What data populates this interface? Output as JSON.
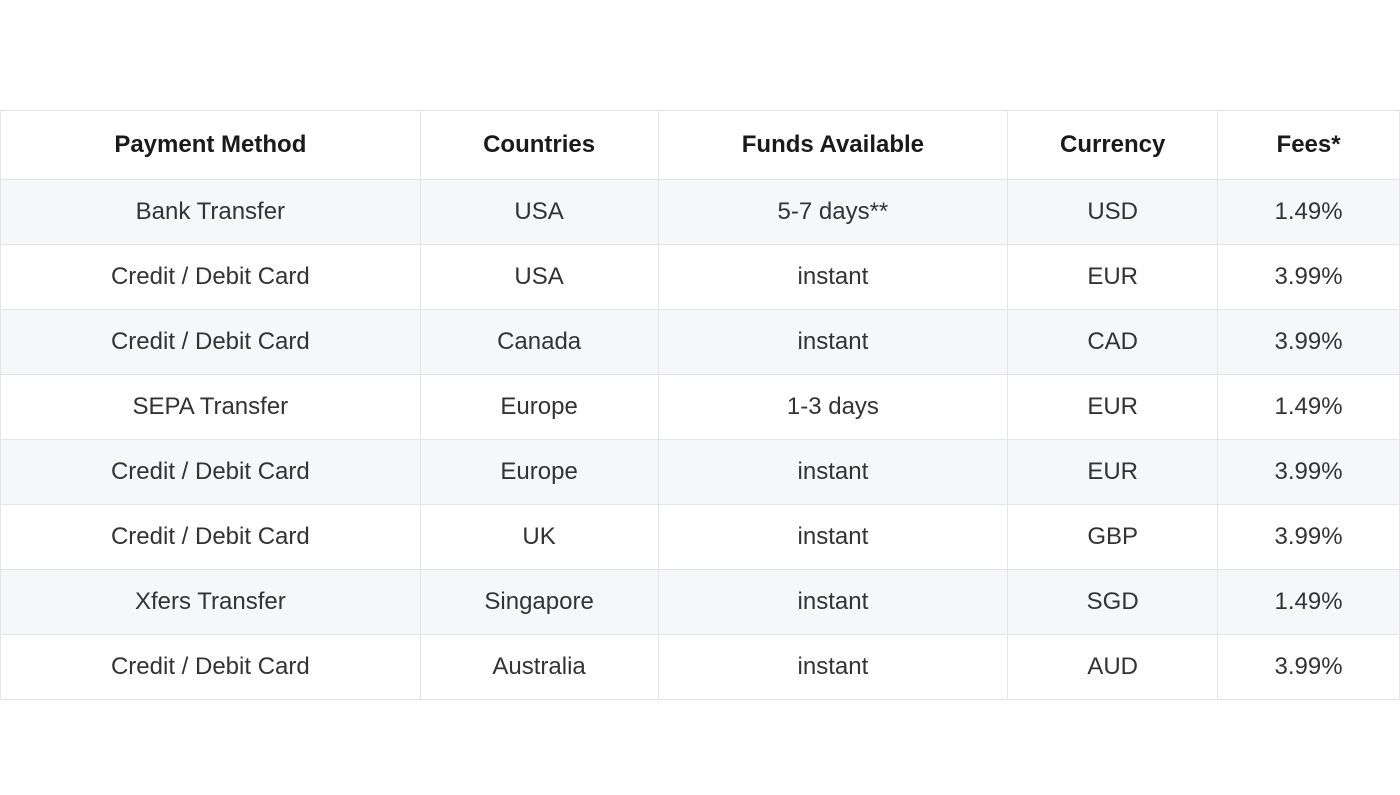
{
  "table": {
    "headers": {
      "method": "Payment Method",
      "countries": "Countries",
      "funds": "Funds Available",
      "currency": "Currency",
      "fees": "Fees*"
    },
    "rows": [
      {
        "method": "Bank Transfer",
        "countries": "USA",
        "funds": "5-7 days**",
        "currency": "USD",
        "fees": "1.49%"
      },
      {
        "method": "Credit / Debit Card",
        "countries": "USA",
        "funds": "instant",
        "currency": "EUR",
        "fees": "3.99%"
      },
      {
        "method": "Credit / Debit Card",
        "countries": "Canada",
        "funds": "instant",
        "currency": "CAD",
        "fees": "3.99%"
      },
      {
        "method": "SEPA Transfer",
        "countries": "Europe",
        "funds": "1-3 days",
        "currency": "EUR",
        "fees": "1.49%"
      },
      {
        "method": "Credit / Debit Card",
        "countries": "Europe",
        "funds": "instant",
        "currency": "EUR",
        "fees": "3.99%"
      },
      {
        "method": "Credit / Debit Card",
        "countries": "UK",
        "funds": "instant",
        "currency": "GBP",
        "fees": "3.99%"
      },
      {
        "method": "Xfers Transfer",
        "countries": "Singapore",
        "funds": "instant",
        "currency": "SGD",
        "fees": "1.49%"
      },
      {
        "method": "Credit / Debit Card",
        "countries": "Australia",
        "funds": "instant",
        "currency": "AUD",
        "fees": "3.99%"
      }
    ]
  }
}
